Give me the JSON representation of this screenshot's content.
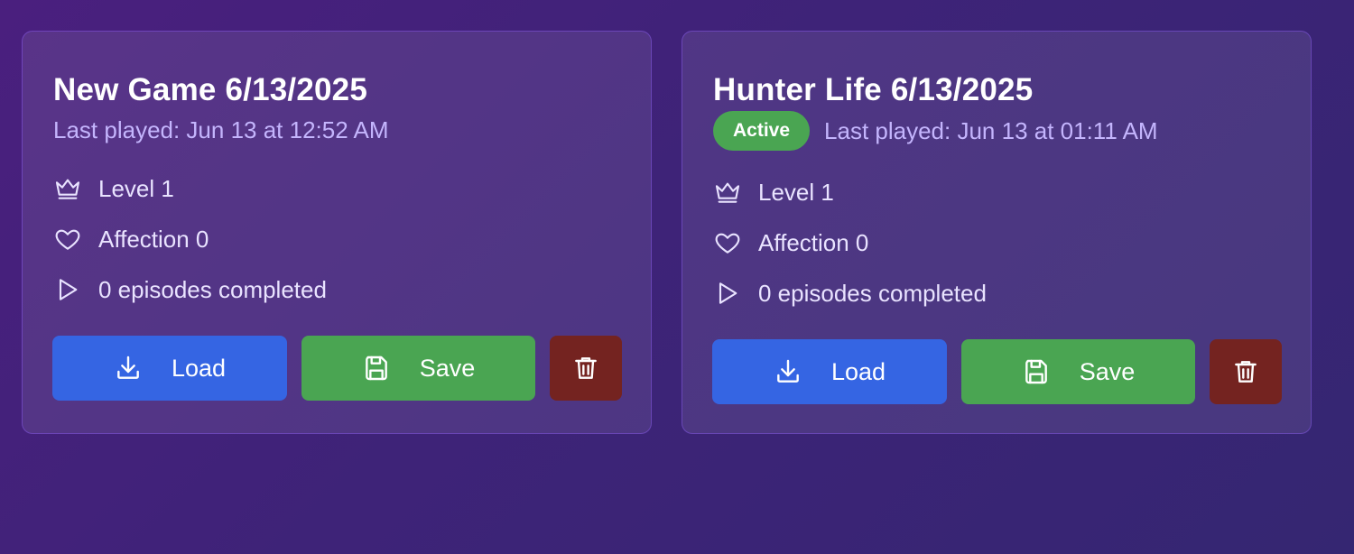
{
  "cards": [
    {
      "title": "New Game 6/13/2025",
      "badge": "",
      "last_played": "Last played: Jun 13 at 12:52 AM",
      "level": "Level 1",
      "affection": "Affection 0",
      "episodes": "0 episodes completed",
      "load_label": "Load",
      "save_label": "Save"
    },
    {
      "title": "Hunter Life 6/13/2025",
      "badge": "Active",
      "last_played": "Last played: Jun 13 at 01:11 AM",
      "level": "Level 1",
      "affection": "Affection 0",
      "episodes": "0 episodes completed",
      "load_label": "Load",
      "save_label": "Save"
    }
  ],
  "icons": {
    "level": "crown-icon",
    "affection": "heart-icon",
    "episodes": "play-icon",
    "load": "download-icon",
    "save": "floppy-disk-icon",
    "delete": "trash-icon"
  },
  "colors": {
    "load_button": "#3565e3",
    "save_button": "#4aa552",
    "delete_button": "#742320",
    "active_badge": "#4aa552",
    "subtext": "#c4b5fd"
  }
}
